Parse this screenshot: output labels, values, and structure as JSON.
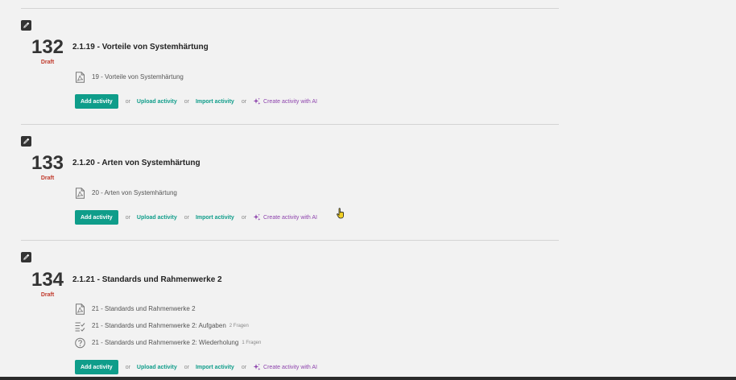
{
  "sections": [
    {
      "number": "132",
      "status": "Draft",
      "title": "2.1.19 - Vorteile von Systemhärtung",
      "items": [
        {
          "icon": "pdf-icon",
          "label": "19 - Vorteile von Systemhärtung",
          "meta": ""
        }
      ]
    },
    {
      "number": "133",
      "status": "Draft",
      "title": "2.1.20 - Arten von Systemhärtung",
      "items": [
        {
          "icon": "pdf-icon",
          "label": "20 - Arten von Systemhärtung",
          "meta": ""
        }
      ]
    },
    {
      "number": "134",
      "status": "Draft",
      "title": "2.1.21 - Standards und Rahmenwerke 2",
      "items": [
        {
          "icon": "pdf-icon",
          "label": "21 - Standards und Rahmenwerke 2",
          "meta": ""
        },
        {
          "icon": "task-list-icon",
          "label": "21 - Standards und Rahmenwerke 2: Aufgaben",
          "meta": "2 Fragen"
        },
        {
          "icon": "question-circle-icon",
          "label": "21 - Standards und Rahmenwerke 2: Wiederholung",
          "meta": "1 Fragen"
        }
      ]
    }
  ],
  "actions": {
    "add_label": "Add activity",
    "or_label": "or",
    "upload_label": "Upload activity",
    "import_label": "Import activity",
    "ai_label": "Create activity with AI",
    "ai_icon": "sparkle-icon"
  },
  "colors": {
    "accent": "#0f9d8a",
    "draft": "#c0392b",
    "ai": "#8e44ad"
  }
}
